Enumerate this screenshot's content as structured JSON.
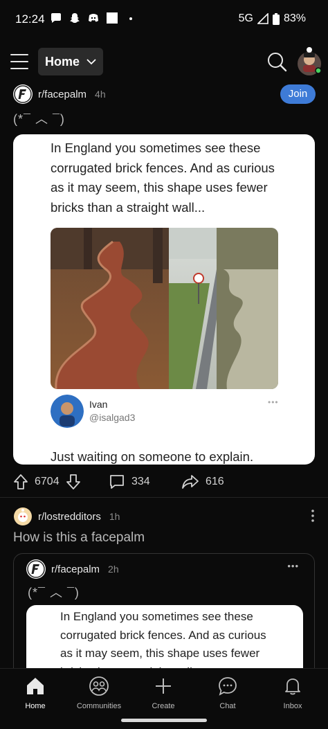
{
  "status_bar": {
    "time": "12:24",
    "network": "5G",
    "battery": "83%"
  },
  "header": {
    "feed_selector": "Home"
  },
  "post1": {
    "subreddit": "r/facepalm",
    "age": "4h",
    "join_label": "Join",
    "title": "(*¯ ︿ ¯)",
    "tweet_text": "In England you sometimes see these corrugated brick fences. And as curious as it may seem, this shape uses fewer bricks than a straight wall...",
    "author_name": "Ivan",
    "author_handle": "@isalgad3",
    "author_more": "•••",
    "caption": "Just waiting on someone to explain.",
    "upvotes": "6704",
    "comments": "334",
    "shares": "616"
  },
  "post2": {
    "subreddit": "r/lostredditors",
    "age": "1h",
    "title": "How is this a facepalm",
    "crosspost": {
      "subreddit": "r/facepalm",
      "age": "2h",
      "title": "(*¯ ︿ ¯)",
      "more": "•••",
      "tweet_text": "In England you sometimes see these corrugated brick fences. And as curious as it may seem, this shape uses fewer bricks than a straight wall..."
    }
  },
  "bottom_nav": {
    "items": [
      {
        "label": "Home",
        "icon": "home-icon"
      },
      {
        "label": "Communities",
        "icon": "communities-icon"
      },
      {
        "label": "Create",
        "icon": "plus-icon"
      },
      {
        "label": "Chat",
        "icon": "chat-icon"
      },
      {
        "label": "Inbox",
        "icon": "bell-icon"
      }
    ]
  },
  "colors": {
    "background": "#0b0b0b",
    "join_button": "#3e7bd7",
    "card": "#ffffff"
  }
}
